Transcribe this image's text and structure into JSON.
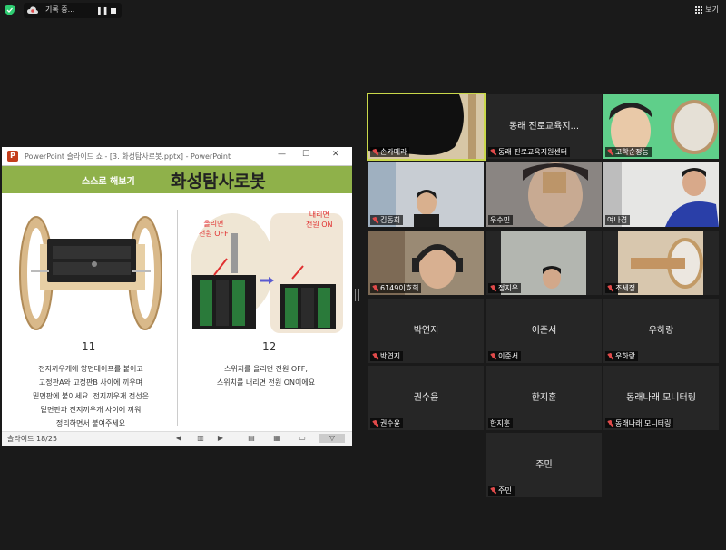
{
  "topbar": {
    "recording_label": "기록 중...",
    "pause_glyph": "❚❚",
    "view_label": "보기",
    "icons": [
      "shield-icon",
      "cloud-record-icon",
      "pause-icon",
      "stop-icon",
      "grid-view-icon"
    ],
    "accent_green": "#2ecc71"
  },
  "ppt": {
    "title": "PowerPoint 슬라이드 쇼 - [3. 화성탐사로봇.pptx] - PowerPoint",
    "logo_letter": "P",
    "window_controls": [
      "—",
      "☐",
      "✕"
    ],
    "band_label": "스스로 해보기",
    "slide_title": "화성탐사로봇",
    "band_color": "#8fb14a",
    "left_step": "11",
    "left_caption": [
      "전지끼우개에 양면테이프를 붙이고",
      "고정판A와 고정판B 사이에 끼우며",
      "밑면판에 붙이세요. 전지끼우개 전선은",
      "밑면판과 전지끼우개 사이에 끼워",
      "정리하면서 붙여주세요"
    ],
    "right_step": "12",
    "right_caption": [
      "스위치를 올리면 전원 OFF,",
      "스위치를 내리면 전원 ON이에요"
    ],
    "off_label": [
      "올리면",
      "전원 OFF"
    ],
    "on_label": [
      "내리면",
      "전원 ON"
    ],
    "status_slide": "슬라이드 18/25"
  },
  "participants": [
    {
      "name": "손카메라",
      "center": "",
      "mic": "off",
      "video": true,
      "active": true
    },
    {
      "name": "동래 진로교육지원센터",
      "center": "동래 진로교육지...",
      "mic": "off",
      "video": false
    },
    {
      "name": "고학순정능",
      "center": "",
      "mic": "off",
      "video": true
    },
    {
      "name": "김동희",
      "center": "",
      "mic": "off",
      "video": true
    },
    {
      "name": "우수민",
      "center": "",
      "mic": "none",
      "video": true
    },
    {
      "name": "여나겸",
      "center": "",
      "mic": "none",
      "video": true
    },
    {
      "name": "6149이효희",
      "center": "",
      "mic": "off",
      "video": true
    },
    {
      "name": "정지우",
      "center": "",
      "mic": "off",
      "video": true
    },
    {
      "name": "조세정",
      "center": "",
      "mic": "off",
      "video": true
    },
    {
      "name": "박연지",
      "center": "박연지",
      "mic": "off",
      "video": false
    },
    {
      "name": "이준서",
      "center": "이준서",
      "mic": "off",
      "video": false
    },
    {
      "name": "우하랑",
      "center": "우하랑",
      "mic": "off",
      "video": false
    },
    {
      "name": "권수윤",
      "center": "권수윤",
      "mic": "off",
      "video": false
    },
    {
      "name": "한지훈",
      "center": "한지훈",
      "mic": "none",
      "video": false
    },
    {
      "name": "동래나래 모니터링",
      "center": "동래나래 모니터링",
      "mic": "off",
      "video": false
    },
    {
      "name": "주민",
      "center": "주민",
      "mic": "off",
      "video": false
    }
  ]
}
